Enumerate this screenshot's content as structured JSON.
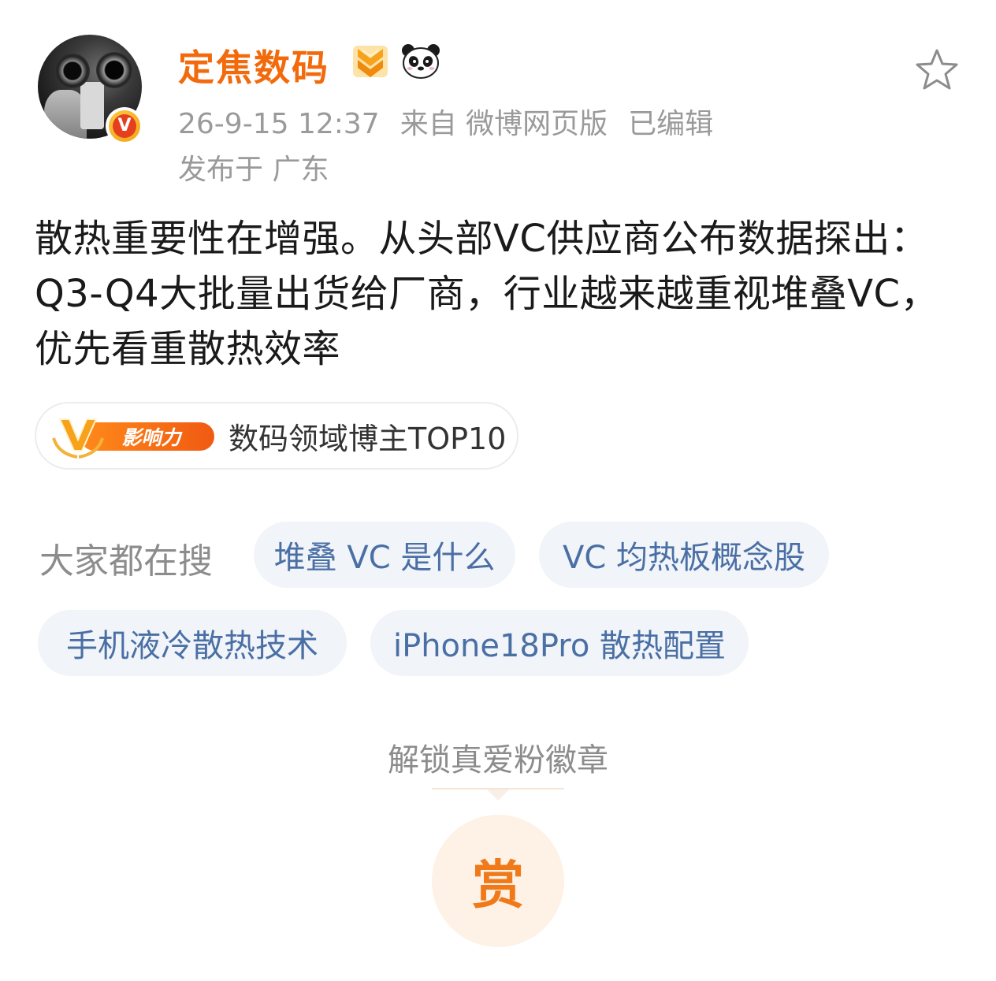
{
  "header": {
    "username": "定焦数码",
    "timestamp": "26-9-15 12:37",
    "source": "来自 微博网页版",
    "edited": "已编辑",
    "location": "发布于 广东"
  },
  "post": {
    "content": "散热重要性在增强。从头部VC供应商公布数据探出：Q3-Q4大批量出货给厂商，行业越来越重视堆叠VC，优先看重散热效率"
  },
  "influence": {
    "badge_label": "影响力",
    "text": "数码领域博主TOP10"
  },
  "search": {
    "label": "大家都在搜",
    "chips": [
      "堆叠 VC 是什么",
      "VC 均热板概念股",
      "手机液冷散热技术",
      "iPhone18Pro 散热配置"
    ]
  },
  "reward": {
    "unlock_text": "解锁真爱粉徽章",
    "tip_label": "赏"
  },
  "colors": {
    "username": "#f26a0b",
    "chip_text": "#4a6fa5",
    "chip_bg": "#f1f4f8",
    "meta": "#9a9a9a",
    "tip": "#f07a1a"
  },
  "icons": {
    "rank": "rank-chevron-icon",
    "panda": "panda-icon",
    "favorite": "star-outline-icon",
    "verified": "verified-v-icon"
  }
}
